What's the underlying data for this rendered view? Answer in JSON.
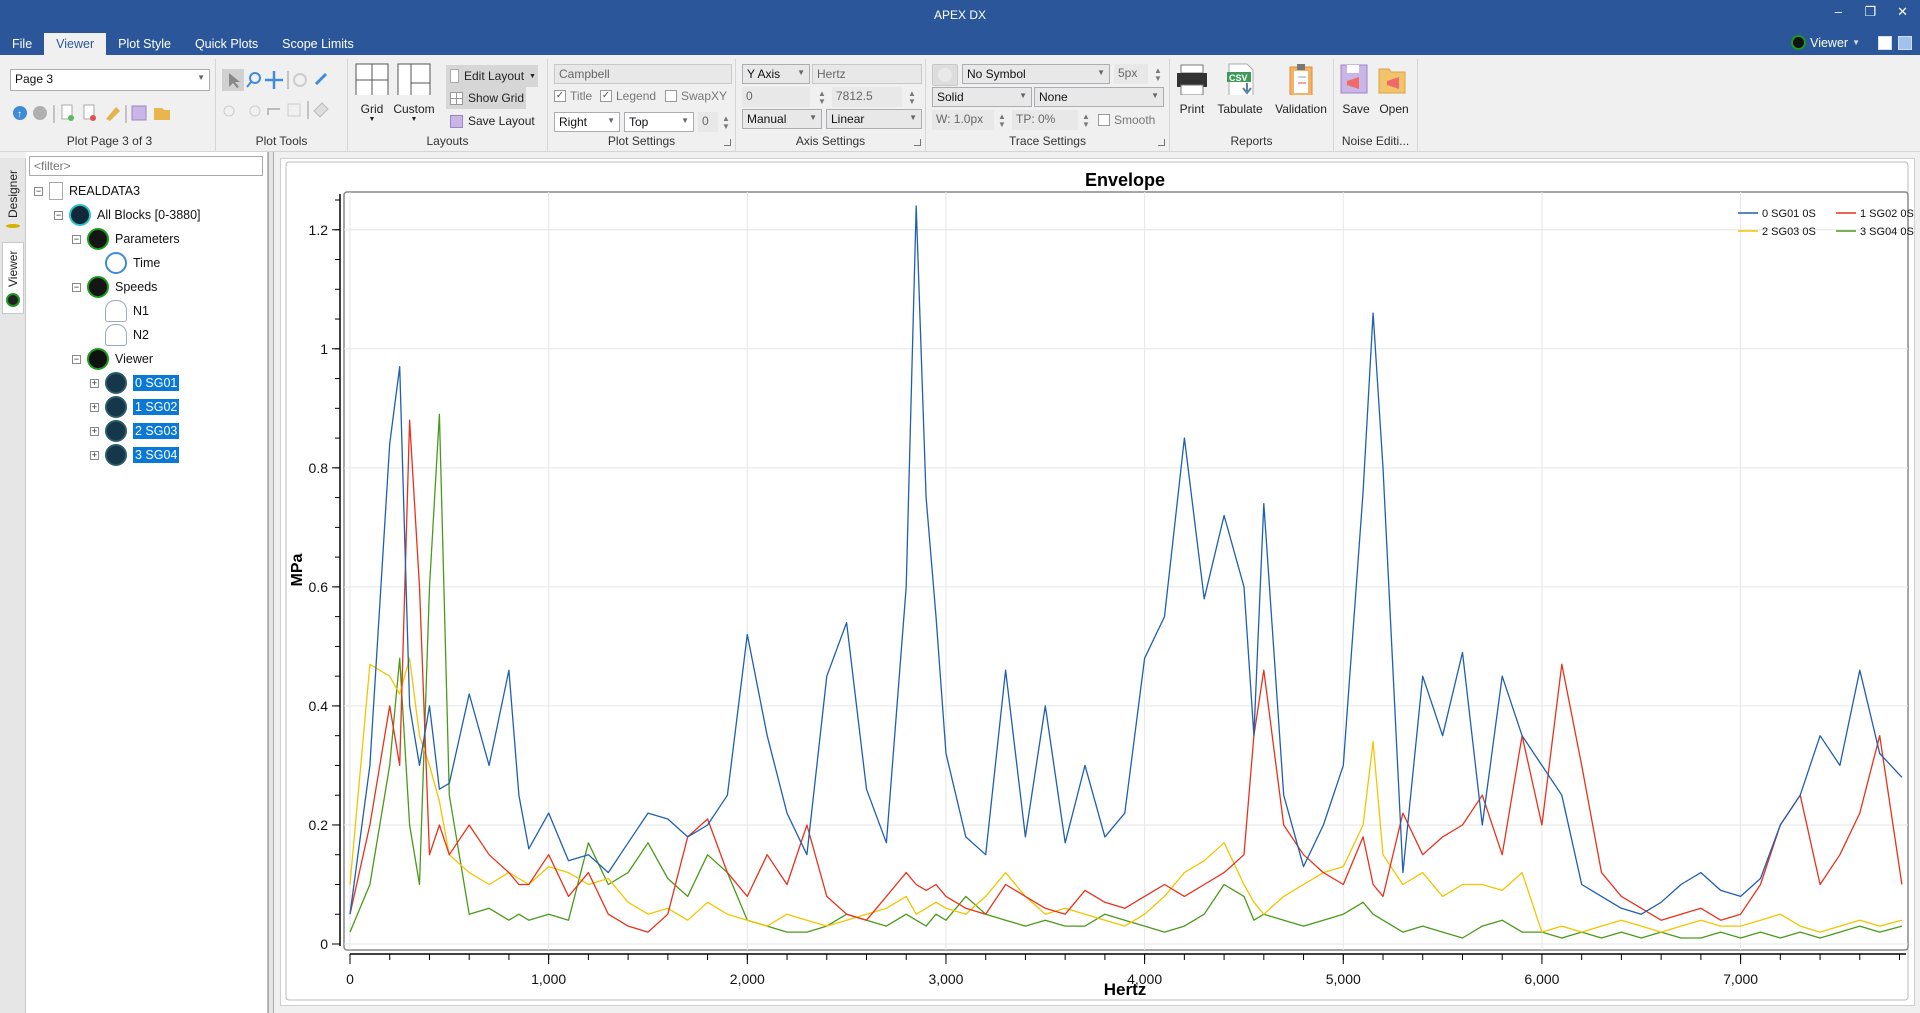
{
  "app": {
    "title": "APEX DX",
    "minimize": "–",
    "restore": "❐",
    "close": "✕"
  },
  "tabs": [
    {
      "label": "File",
      "active": false
    },
    {
      "label": "Viewer",
      "active": true
    },
    {
      "label": "Plot Style",
      "active": false
    },
    {
      "label": "Quick Plots",
      "active": false
    },
    {
      "label": "Scope Limits",
      "active": false
    }
  ],
  "viewer_switch": {
    "label": "Viewer"
  },
  "ribbon": {
    "plot_page": {
      "page_select": "Page 3",
      "label": "Plot Page 3 of 3"
    },
    "plot_tools": {
      "label": "Plot Tools"
    },
    "layouts": {
      "grid": "Grid",
      "custom": "Custom",
      "edit_layout": "Edit Layout",
      "show_grid": "Show Grid",
      "save_layout": "Save Layout",
      "label": "Layouts"
    },
    "plot_settings": {
      "plot_type": "Campbell",
      "title": "Title",
      "title_checked": true,
      "legend": "Legend",
      "legend_checked": true,
      "swapxy": "SwapXY",
      "swapxy_checked": false,
      "legend_h": "Right",
      "legend_v": "Top",
      "legend_offset": "0",
      "label": "Plot Settings"
    },
    "axis_settings": {
      "axis": "Y Axis",
      "axis_name": "Hertz",
      "min": "0",
      "max": "7812.5",
      "mode": "Manual",
      "scale": "Linear",
      "label": "Axis Settings"
    },
    "trace_settings": {
      "symbol": "No Symbol",
      "symbol_size": "5px",
      "line_style": "Solid",
      "fill": "None",
      "width": "W: 1.0px",
      "transparency": "TP: 0%",
      "smooth": "Smooth",
      "smooth_checked": false,
      "label": "Trace Settings"
    },
    "reports": {
      "print": "Print",
      "tabulate": "Tabulate",
      "validation": "Validation",
      "label": "Reports"
    },
    "noise": {
      "save": "Save",
      "open": "Open",
      "label": "Noise Editi..."
    }
  },
  "side_tabs": [
    {
      "label": "Designer",
      "active": false
    },
    {
      "label": "Viewer",
      "active": true
    }
  ],
  "tree": {
    "filter_placeholder": "<filter>",
    "nodes": [
      {
        "label": "REALDATA3",
        "level": 0,
        "icon": "document-icon",
        "expander": "−"
      },
      {
        "label": "All Blocks [0-3880]",
        "level": 1,
        "icon": "blocks-icon",
        "expander": "−"
      },
      {
        "label": "Parameters",
        "level": 2,
        "icon": "gauge-icon",
        "expander": "−"
      },
      {
        "label": "Time",
        "level": 3,
        "icon": "stopwatch-icon",
        "expander": ""
      },
      {
        "label": "Speeds",
        "level": 2,
        "icon": "gauge-icon",
        "expander": "−"
      },
      {
        "label": "N1",
        "level": 3,
        "icon": "speedometer-icon",
        "expander": ""
      },
      {
        "label": "N2",
        "level": 3,
        "icon": "speedometer-icon",
        "expander": ""
      },
      {
        "label": "Viewer",
        "level": 2,
        "icon": "binoculars-icon",
        "expander": "−"
      },
      {
        "label": "0 SG01",
        "level": 3,
        "icon": "signal-icon",
        "expander": "+",
        "selected": true
      },
      {
        "label": "1 SG02",
        "level": 3,
        "icon": "signal-icon",
        "expander": "+",
        "selected": true
      },
      {
        "label": "2 SG03",
        "level": 3,
        "icon": "signal-icon",
        "expander": "+",
        "selected": true
      },
      {
        "label": "3 SG04",
        "level": 3,
        "icon": "signal-icon",
        "expander": "+",
        "selected": true
      }
    ]
  },
  "chart_data": {
    "type": "line",
    "title": "Envelope",
    "xlabel": "Hertz",
    "ylabel": "MPa",
    "xlim": [
      0,
      7812.5
    ],
    "ylim": [
      0,
      1.25
    ],
    "xticks": [
      0,
      1000,
      2000,
      3000,
      4000,
      5000,
      6000,
      7000
    ],
    "xtick_labels": [
      "0",
      "1,000",
      "2,000",
      "3,000",
      "4,000",
      "5,000",
      "6,000",
      "7,000"
    ],
    "yticks": [
      0,
      0.2,
      0.4,
      0.6,
      0.8,
      1,
      1.2
    ],
    "ytick_labels": [
      "0",
      "0.2",
      "0.4",
      "0.6",
      "0.8",
      "1",
      "1.2"
    ],
    "grid": true,
    "legend_position": "top-right",
    "x": [
      0,
      100,
      200,
      250,
      300,
      350,
      400,
      450,
      500,
      600,
      700,
      800,
      850,
      900,
      1000,
      1100,
      1200,
      1300,
      1400,
      1500,
      1600,
      1700,
      1800,
      1900,
      2000,
      2100,
      2200,
      2300,
      2400,
      2500,
      2600,
      2700,
      2800,
      2850,
      2900,
      2950,
      3000,
      3100,
      3200,
      3300,
      3400,
      3500,
      3600,
      3700,
      3800,
      3900,
      4000,
      4100,
      4200,
      4300,
      4400,
      4500,
      4550,
      4600,
      4700,
      4800,
      4900,
      5000,
      5100,
      5150,
      5200,
      5300,
      5400,
      5500,
      5600,
      5700,
      5800,
      5900,
      6000,
      6100,
      6200,
      6300,
      6400,
      6500,
      6600,
      6700,
      6800,
      6900,
      7000,
      7100,
      7200,
      7300,
      7400,
      7500,
      7600,
      7700,
      7812
    ],
    "series": [
      {
        "name": "0 SG01 0S",
        "color": "#1f5fb0",
        "values": [
          0.05,
          0.3,
          0.84,
          0.97,
          0.4,
          0.3,
          0.4,
          0.26,
          0.27,
          0.42,
          0.3,
          0.46,
          0.25,
          0.16,
          0.22,
          0.14,
          0.15,
          0.12,
          0.17,
          0.22,
          0.21,
          0.18,
          0.2,
          0.25,
          0.52,
          0.35,
          0.22,
          0.15,
          0.45,
          0.54,
          0.26,
          0.17,
          0.6,
          1.24,
          0.75,
          0.55,
          0.32,
          0.18,
          0.15,
          0.46,
          0.18,
          0.4,
          0.17,
          0.3,
          0.18,
          0.22,
          0.48,
          0.55,
          0.85,
          0.58,
          0.72,
          0.6,
          0.35,
          0.74,
          0.25,
          0.13,
          0.2,
          0.3,
          0.76,
          1.06,
          0.8,
          0.12,
          0.45,
          0.35,
          0.49,
          0.2,
          0.45,
          0.35,
          0.3,
          0.25,
          0.1,
          0.08,
          0.06,
          0.05,
          0.07,
          0.1,
          0.12,
          0.09,
          0.08,
          0.11,
          0.2,
          0.25,
          0.35,
          0.3,
          0.46,
          0.32,
          0.28
        ]
      },
      {
        "name": "1 SG02 0S",
        "color": "#e8321c",
        "values": [
          0.05,
          0.2,
          0.4,
          0.3,
          0.88,
          0.6,
          0.15,
          0.2,
          0.15,
          0.2,
          0.15,
          0.12,
          0.1,
          0.1,
          0.15,
          0.08,
          0.12,
          0.05,
          0.03,
          0.02,
          0.05,
          0.18,
          0.21,
          0.12,
          0.08,
          0.15,
          0.1,
          0.2,
          0.08,
          0.05,
          0.04,
          0.08,
          0.12,
          0.1,
          0.09,
          0.1,
          0.08,
          0.06,
          0.05,
          0.1,
          0.08,
          0.06,
          0.05,
          0.09,
          0.07,
          0.06,
          0.08,
          0.1,
          0.08,
          0.1,
          0.12,
          0.15,
          0.35,
          0.46,
          0.2,
          0.15,
          0.12,
          0.1,
          0.18,
          0.1,
          0.08,
          0.22,
          0.15,
          0.18,
          0.2,
          0.25,
          0.15,
          0.35,
          0.2,
          0.47,
          0.3,
          0.12,
          0.08,
          0.06,
          0.04,
          0.05,
          0.06,
          0.04,
          0.05,
          0.1,
          0.2,
          0.25,
          0.1,
          0.15,
          0.22,
          0.35,
          0.1
        ]
      },
      {
        "name": "2 SG03 0S",
        "color": "#f2c500",
        "values": [
          0.1,
          0.47,
          0.45,
          0.42,
          0.48,
          0.35,
          0.3,
          0.24,
          0.15,
          0.12,
          0.1,
          0.12,
          0.11,
          0.1,
          0.13,
          0.12,
          0.1,
          0.11,
          0.07,
          0.05,
          0.06,
          0.04,
          0.07,
          0.05,
          0.04,
          0.03,
          0.05,
          0.04,
          0.03,
          0.04,
          0.05,
          0.06,
          0.08,
          0.05,
          0.06,
          0.07,
          0.06,
          0.05,
          0.08,
          0.12,
          0.08,
          0.05,
          0.06,
          0.05,
          0.04,
          0.03,
          0.05,
          0.08,
          0.12,
          0.14,
          0.17,
          0.1,
          0.07,
          0.05,
          0.08,
          0.1,
          0.12,
          0.13,
          0.2,
          0.34,
          0.15,
          0.1,
          0.12,
          0.08,
          0.1,
          0.1,
          0.09,
          0.12,
          0.02,
          0.03,
          0.02,
          0.03,
          0.04,
          0.03,
          0.02,
          0.03,
          0.04,
          0.03,
          0.03,
          0.04,
          0.05,
          0.03,
          0.02,
          0.03,
          0.04,
          0.03,
          0.04
        ]
      },
      {
        "name": "3 SG04 0S",
        "color": "#4a9a1a",
        "values": [
          0.02,
          0.1,
          0.3,
          0.48,
          0.2,
          0.1,
          0.6,
          0.89,
          0.25,
          0.05,
          0.06,
          0.04,
          0.05,
          0.04,
          0.05,
          0.04,
          0.17,
          0.1,
          0.12,
          0.17,
          0.11,
          0.08,
          0.15,
          0.12,
          0.04,
          0.03,
          0.02,
          0.02,
          0.03,
          0.05,
          0.04,
          0.03,
          0.05,
          0.04,
          0.03,
          0.05,
          0.04,
          0.08,
          0.05,
          0.04,
          0.03,
          0.04,
          0.03,
          0.03,
          0.05,
          0.04,
          0.03,
          0.02,
          0.03,
          0.05,
          0.1,
          0.08,
          0.04,
          0.05,
          0.04,
          0.03,
          0.04,
          0.05,
          0.07,
          0.05,
          0.04,
          0.02,
          0.03,
          0.02,
          0.01,
          0.03,
          0.04,
          0.02,
          0.02,
          0.01,
          0.02,
          0.01,
          0.02,
          0.01,
          0.02,
          0.01,
          0.01,
          0.02,
          0.01,
          0.02,
          0.01,
          0.02,
          0.01,
          0.02,
          0.03,
          0.02,
          0.03
        ]
      }
    ]
  }
}
